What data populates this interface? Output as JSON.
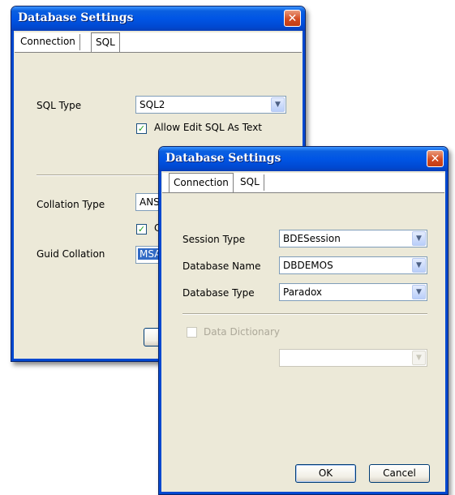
{
  "back_window": {
    "title": "Database Settings",
    "close_label": "✕",
    "tabs": [
      {
        "label": "Connection"
      },
      {
        "label": "SQL"
      }
    ],
    "active_tab": "SQL",
    "sql_type_label": "SQL Type",
    "sql_type_value": "SQL2",
    "allow_edit_label": "Allow Edit SQL As Text",
    "allow_edit_checked": true,
    "collation_type_label": "Collation Type",
    "collation_type_value": "ANS",
    "collation_check_label": "C",
    "guid_collation_label": "Guid Collation",
    "guid_collation_value": "MSA"
  },
  "front_window": {
    "title": "Database Settings",
    "close_label": "✕",
    "tabs": [
      {
        "label": "Connection"
      },
      {
        "label": "SQL"
      }
    ],
    "active_tab": "Connection",
    "session_type_label": "Session Type",
    "session_type_value": "BDESession",
    "database_name_label": "Database Name",
    "database_name_value": "DBDEMOS",
    "database_type_label": "Database Type",
    "database_type_value": "Paradox",
    "data_dictionary_label": "Data Dictionary",
    "data_dictionary_checked": false,
    "data_dictionary_value": "",
    "ok_label": "OK",
    "cancel_label": "Cancel"
  },
  "colors": {
    "titlebar": "#0055e5",
    "window_face": "#ece9d8",
    "close_button": "#d34c22",
    "selection": "#316ac5"
  }
}
